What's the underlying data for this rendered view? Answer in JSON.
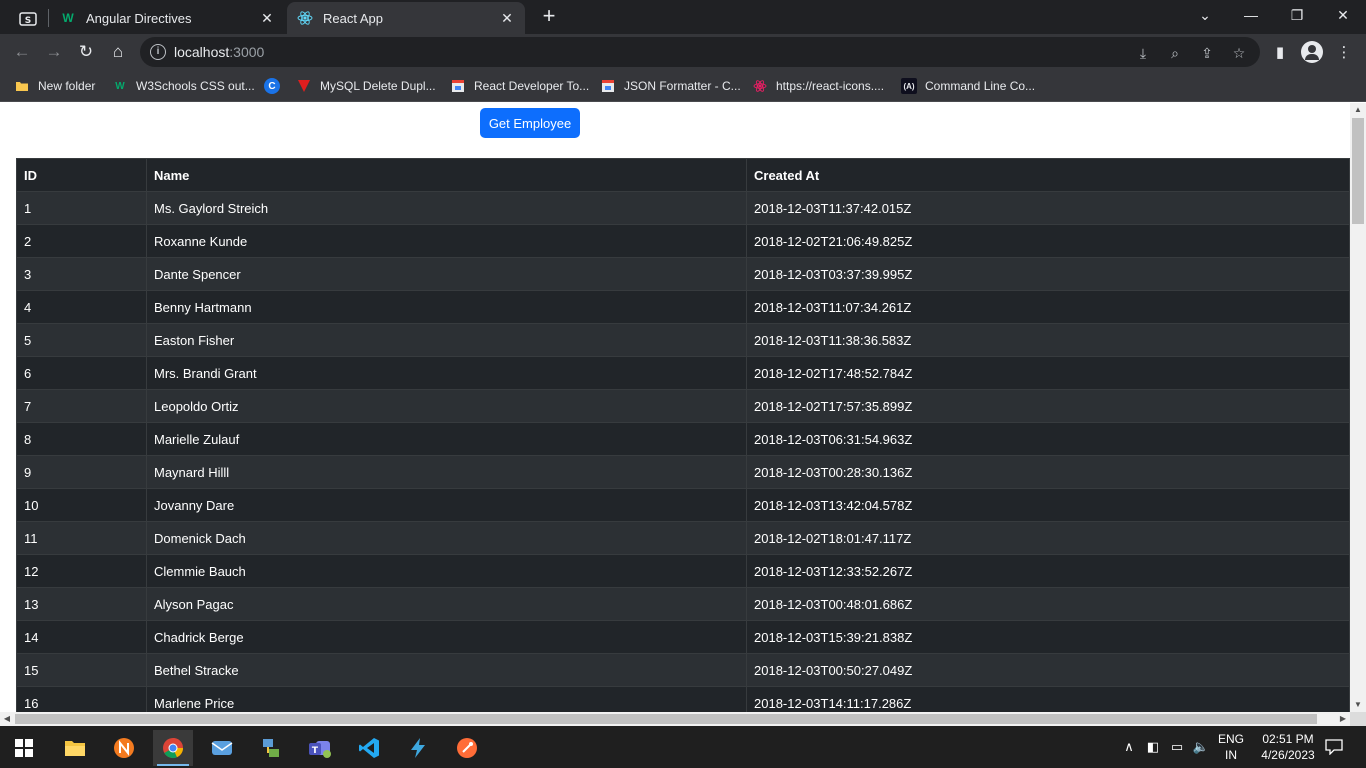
{
  "browser": {
    "tabs": [
      {
        "title": "Angular Directives",
        "favicon": "w3schools-icon",
        "active": false
      },
      {
        "title": "React App",
        "favicon": "react-icon",
        "active": true
      }
    ],
    "address": {
      "host": "localhost",
      "port": ":3000"
    },
    "bookmarks": [
      {
        "label": "New folder",
        "icon": "folder-icon",
        "color": "#f9c74f"
      },
      {
        "label": "W3Schools CSS out...",
        "icon": "w3schools-icon",
        "color": "#04aa6d"
      },
      {
        "label": "",
        "icon": "google-c-icon",
        "color": "#1a73e8"
      },
      {
        "label": "MySQL Delete Dupl...",
        "icon": "v-logo-icon",
        "color": "#e01e1e"
      },
      {
        "label": "React Developer To...",
        "icon": "store-icon",
        "color": "#ea4335"
      },
      {
        "label": "JSON Formatter - C...",
        "icon": "store-icon",
        "color": "#ea4335"
      },
      {
        "label": "https://react-icons....",
        "icon": "react-icons-icon",
        "color": "#e91e63"
      },
      {
        "label": "Command Line Co...",
        "icon": "angular-icon",
        "color": "#c3002f"
      }
    ]
  },
  "page": {
    "button_label": "Get Employee",
    "table": {
      "headers": [
        "ID",
        "Name",
        "Created At"
      ],
      "rows": [
        [
          "1",
          "Ms. Gaylord Streich",
          "2018-12-03T11:37:42.015Z"
        ],
        [
          "2",
          "Roxanne Kunde",
          "2018-12-02T21:06:49.825Z"
        ],
        [
          "3",
          "Dante Spencer",
          "2018-12-03T03:37:39.995Z"
        ],
        [
          "4",
          "Benny Hartmann",
          "2018-12-03T11:07:34.261Z"
        ],
        [
          "5",
          "Easton Fisher",
          "2018-12-03T11:38:36.583Z"
        ],
        [
          "6",
          "Mrs. Brandi Grant",
          "2018-12-02T17:48:52.784Z"
        ],
        [
          "7",
          "Leopoldo Ortiz",
          "2018-12-02T17:57:35.899Z"
        ],
        [
          "8",
          "Marielle Zulauf",
          "2018-12-03T06:31:54.963Z"
        ],
        [
          "9",
          "Maynard Hilll",
          "2018-12-03T00:28:30.136Z"
        ],
        [
          "10",
          "Jovanny Dare",
          "2018-12-03T13:42:04.578Z"
        ],
        [
          "11",
          "Domenick Dach",
          "2018-12-02T18:01:47.117Z"
        ],
        [
          "12",
          "Clemmie Bauch",
          "2018-12-03T12:33:52.267Z"
        ],
        [
          "13",
          "Alyson Pagac",
          "2018-12-03T00:48:01.686Z"
        ],
        [
          "14",
          "Chadrick Berge",
          "2018-12-03T15:39:21.838Z"
        ],
        [
          "15",
          "Bethel Stracke",
          "2018-12-03T00:50:27.049Z"
        ],
        [
          "16",
          "Marlene Price",
          "2018-12-03T14:11:17.286Z"
        ]
      ]
    }
  },
  "taskbar": {
    "apps": [
      {
        "name": "file-explorer-icon",
        "active": false
      },
      {
        "name": "app-icon",
        "active": false
      },
      {
        "name": "chrome-icon",
        "active": true
      },
      {
        "name": "mail-icon",
        "active": false
      },
      {
        "name": "network-app-icon",
        "active": false
      },
      {
        "name": "teams-icon",
        "active": false
      },
      {
        "name": "vscode-icon",
        "active": false
      },
      {
        "name": "bolt-icon",
        "active": false
      },
      {
        "name": "postman-icon",
        "active": false
      }
    ],
    "language": "ENG",
    "region": "IN",
    "time": "02:51 PM",
    "date": "4/26/2023"
  },
  "colors": {
    "accent": "#0d6efd",
    "table_dark": "#212529",
    "table_striped": "#2c3034"
  }
}
